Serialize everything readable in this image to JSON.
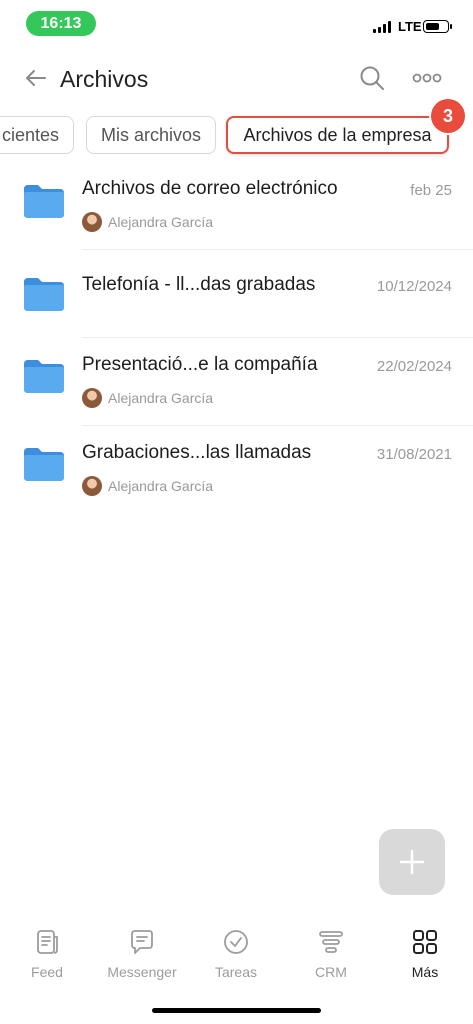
{
  "status_bar": {
    "time": "16:13",
    "network": "LTE",
    "battery_level": 0.7
  },
  "header": {
    "title": "Archivos"
  },
  "tabs": [
    {
      "label": "Recientes",
      "visible_label": "cientes"
    },
    {
      "label": "Mis archivos"
    },
    {
      "label": "Archivos de la empresa",
      "active": true
    }
  ],
  "badge": {
    "count": "3"
  },
  "files": [
    {
      "name": "Archivos de correo electrónico",
      "date": "feb 25",
      "author": "Alejandra García"
    },
    {
      "name": "Telefonía - ll...das grabadas",
      "date": "10/12/2024",
      "author": ""
    },
    {
      "name": "Presentació...e la compañía",
      "date": "22/02/2024",
      "author": "Alejandra García"
    },
    {
      "name": "Grabaciones...las llamadas",
      "date": "31/08/2021",
      "author": "Alejandra García"
    }
  ],
  "bottom_nav": [
    {
      "label": "Feed",
      "icon": "feed-icon"
    },
    {
      "label": "Messenger",
      "icon": "messenger-icon"
    },
    {
      "label": "Tareas",
      "icon": "tasks-icon"
    },
    {
      "label": "CRM",
      "icon": "crm-icon"
    },
    {
      "label": "Más",
      "icon": "more-grid-icon",
      "active": true
    }
  ],
  "colors": {
    "accent": "#e94b3c",
    "folder": "#4a9fe8",
    "status_pill": "#34c759"
  }
}
